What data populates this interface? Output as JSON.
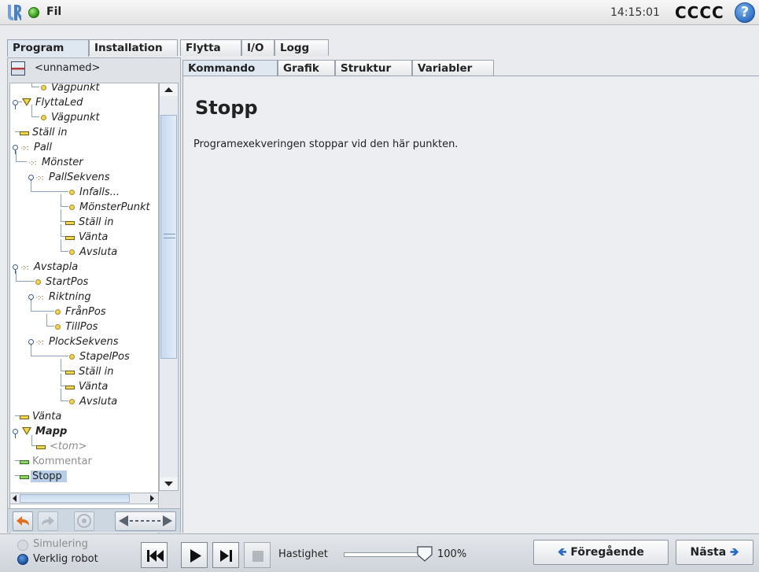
{
  "header": {
    "menu_label": "Fil",
    "time": "14:15:01",
    "robot_name": "CCCC",
    "help_icon": "?"
  },
  "main_tabs": [
    {
      "label": "Program",
      "active": true
    },
    {
      "label": "Installation",
      "active": false
    },
    {
      "label": "Flytta",
      "active": false
    },
    {
      "label": "I/O",
      "active": false
    },
    {
      "label": "Logg",
      "active": false
    }
  ],
  "program": {
    "name": "<unnamed>"
  },
  "tree": [
    {
      "label": "Vägpunkt",
      "icon": "waypoint"
    },
    {
      "label": "FlyttaLed",
      "icon": "move"
    },
    {
      "label": "Vägpunkt",
      "icon": "waypoint"
    },
    {
      "label": "Ställ in",
      "icon": "set"
    },
    {
      "label": "Pall",
      "icon": "pallet"
    },
    {
      "label": "Mönster",
      "icon": "pattern"
    },
    {
      "label": "PallSekvens",
      "icon": "pattern"
    },
    {
      "label": "Infalls...",
      "icon": "waypoint"
    },
    {
      "label": "MönsterPunkt",
      "icon": "waypoint"
    },
    {
      "label": "Ställ in",
      "icon": "set"
    },
    {
      "label": "Vänta",
      "icon": "wait"
    },
    {
      "label": "Avsluta",
      "icon": "waypoint"
    },
    {
      "label": "Avstapla",
      "icon": "pallet"
    },
    {
      "label": "StartPos",
      "icon": "waypoint"
    },
    {
      "label": "Riktning",
      "icon": "pattern"
    },
    {
      "label": "FrånPos",
      "icon": "waypoint"
    },
    {
      "label": "TillPos",
      "icon": "waypoint"
    },
    {
      "label": "PlockSekvens",
      "icon": "pattern"
    },
    {
      "label": "StapelPos",
      "icon": "waypoint"
    },
    {
      "label": "Ställ in",
      "icon": "set"
    },
    {
      "label": "Vänta",
      "icon": "wait"
    },
    {
      "label": "Avsluta",
      "icon": "waypoint"
    },
    {
      "label": "Vänta",
      "icon": "wait"
    },
    {
      "label": "Mapp",
      "icon": "folder"
    },
    {
      "label": "<tom>",
      "icon": "empty"
    },
    {
      "label": "Kommentar",
      "icon": "comment"
    },
    {
      "label": "Stopp",
      "icon": "stop",
      "selected": true
    }
  ],
  "content_tabs": [
    {
      "label": "Kommando",
      "active": true
    },
    {
      "label": "Grafik",
      "active": false
    },
    {
      "label": "Struktur",
      "active": false
    },
    {
      "label": "Variabler",
      "active": false
    }
  ],
  "command": {
    "title": "Stopp",
    "description": "Programexekveringen stoppar vid den här punkten."
  },
  "bottom": {
    "simulation_label": "Simulering",
    "real_robot_label": "Verklig robot",
    "speed_label": "Hastighet",
    "speed_value": "100%",
    "speed_fraction": 1.0,
    "prev_label": "Föregående",
    "next_label": "Nästa"
  },
  "colors": {
    "accent_blue": "#2a6bc2",
    "status_green": "#2d8f14",
    "selection": "#b7cde8"
  }
}
